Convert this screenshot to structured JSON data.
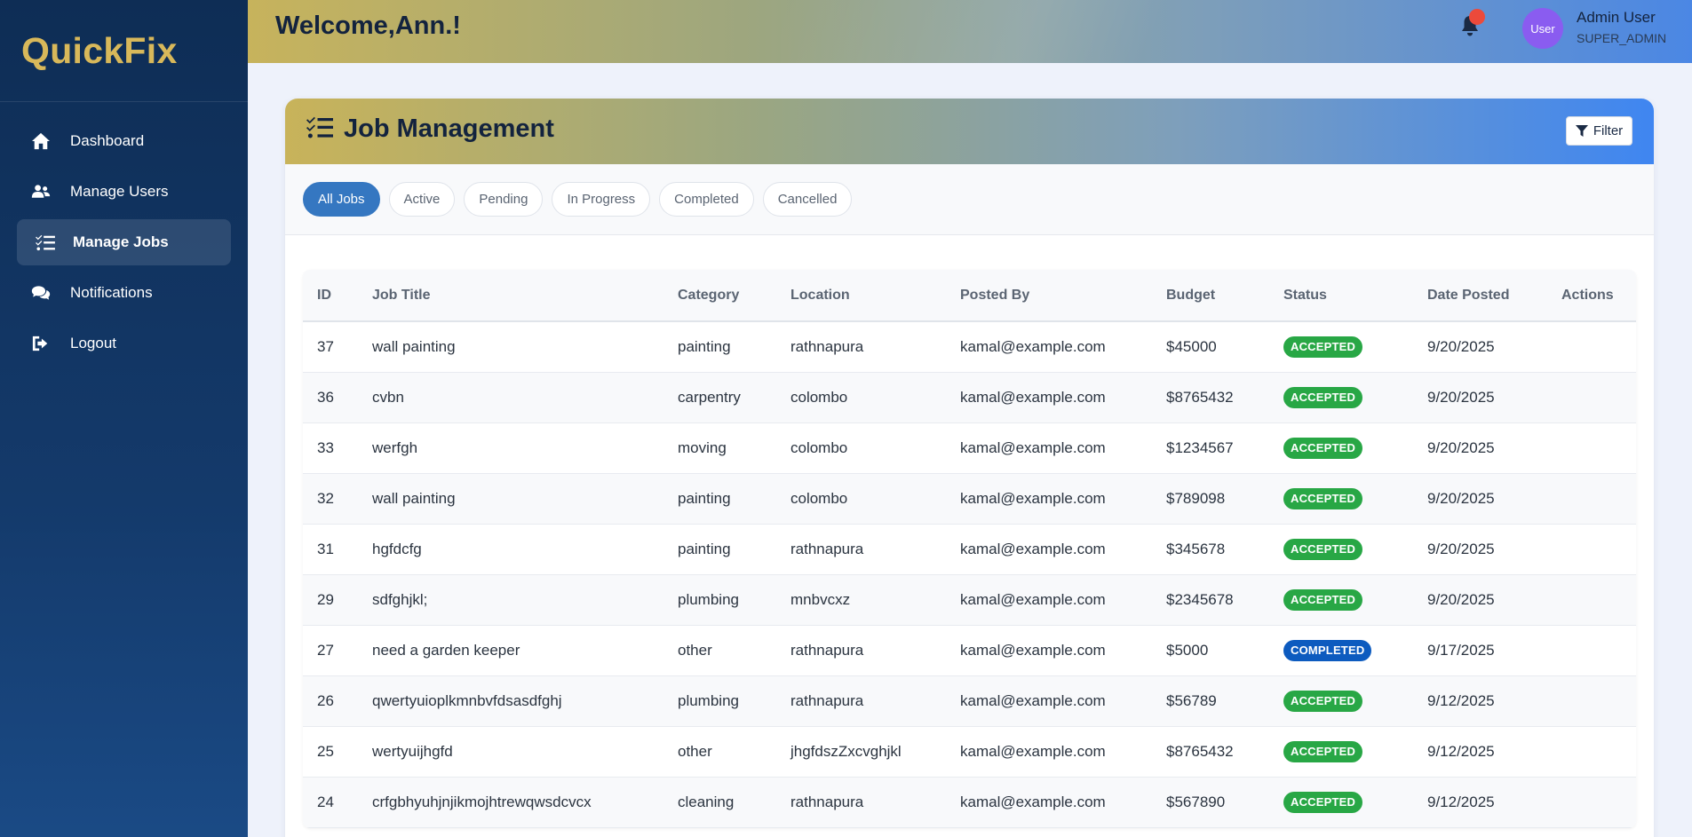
{
  "app": {
    "brand": "QuickFix"
  },
  "sidebar": {
    "items": [
      {
        "label": "Dashboard",
        "icon": "home-icon"
      },
      {
        "label": "Manage Users",
        "icon": "users-icon"
      },
      {
        "label": "Manage Jobs",
        "icon": "tasks-icon",
        "active": true
      },
      {
        "label": "Notifications",
        "icon": "chat-icon"
      },
      {
        "label": "Logout",
        "icon": "logout-icon"
      }
    ]
  },
  "header": {
    "welcome": "Welcome,Ann.!",
    "avatar_text": "User",
    "user_name": "Admin User",
    "user_role": "SUPER_ADMIN"
  },
  "card": {
    "title": "Job Management",
    "filter_label": "Filter"
  },
  "tabs": [
    "All Jobs",
    "Active",
    "Pending",
    "In Progress",
    "Completed",
    "Cancelled"
  ],
  "table": {
    "columns": [
      "ID",
      "Job Title",
      "Category",
      "Location",
      "Posted By",
      "Budget",
      "Status",
      "Date Posted",
      "Actions"
    ],
    "rows": [
      {
        "id": "37",
        "title": "wall painting",
        "category": "painting",
        "location": "rathnapura",
        "posted_by": "kamal@example.com",
        "budget": "$45000",
        "status": "ACCEPTED",
        "date": "9/20/2025"
      },
      {
        "id": "36",
        "title": "cvbn",
        "category": "carpentry",
        "location": "colombo",
        "posted_by": "kamal@example.com",
        "budget": "$8765432",
        "status": "ACCEPTED",
        "date": "9/20/2025"
      },
      {
        "id": "33",
        "title": "werfgh",
        "category": "moving",
        "location": "colombo",
        "posted_by": "kamal@example.com",
        "budget": "$1234567",
        "status": "ACCEPTED",
        "date": "9/20/2025"
      },
      {
        "id": "32",
        "title": "wall painting",
        "category": "painting",
        "location": "colombo",
        "posted_by": "kamal@example.com",
        "budget": "$789098",
        "status": "ACCEPTED",
        "date": "9/20/2025"
      },
      {
        "id": "31",
        "title": "hgfdcfg",
        "category": "painting",
        "location": "rathnapura",
        "posted_by": "kamal@example.com",
        "budget": "$345678",
        "status": "ACCEPTED",
        "date": "9/20/2025"
      },
      {
        "id": "29",
        "title": "sdfghjkl;",
        "category": "plumbing",
        "location": "mnbvcxz",
        "posted_by": "kamal@example.com",
        "budget": "$2345678",
        "status": "ACCEPTED",
        "date": "9/20/2025"
      },
      {
        "id": "27",
        "title": "need a garden keeper",
        "category": "other",
        "location": "rathnapura",
        "posted_by": "kamal@example.com",
        "budget": "$5000",
        "status": "COMPLETED",
        "date": "9/17/2025"
      },
      {
        "id": "26",
        "title": "qwertyuioplkmnbvfdsasdfghj",
        "category": "plumbing",
        "location": "rathnapura",
        "posted_by": "kamal@example.com",
        "budget": "$56789",
        "status": "ACCEPTED",
        "date": "9/12/2025"
      },
      {
        "id": "25",
        "title": "wertyuijhgfd",
        "category": "other",
        "location": "jhgfdszZxcvghjkl",
        "posted_by": "kamal@example.com",
        "budget": "$8765432",
        "status": "ACCEPTED",
        "date": "9/12/2025"
      },
      {
        "id": "24",
        "title": "crfgbhyuhjnjikmojhtrewqwsdcvcx",
        "category": "cleaning",
        "location": "rathnapura",
        "posted_by": "kamal@example.com",
        "budget": "$567890",
        "status": "ACCEPTED",
        "date": "9/12/2025"
      }
    ]
  },
  "colors": {
    "accepted": "#28a745",
    "completed": "#0d5bbf",
    "brand": "#d8b85a",
    "active_tab": "#3577c1"
  }
}
